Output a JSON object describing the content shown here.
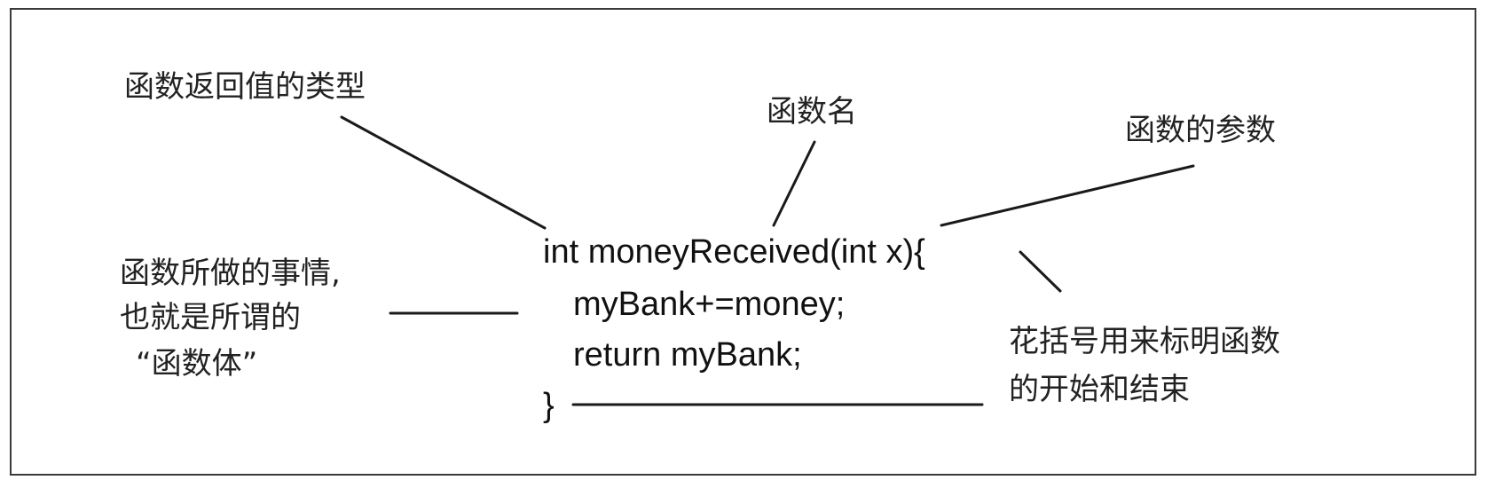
{
  "labels": {
    "return_type": "函数返回值的类型",
    "function_name": "函数名",
    "parameters": "函数的参数",
    "body_line1": "函数所做的事情,",
    "body_line2": "也就是所谓的",
    "body_line3": "“函数体”",
    "braces_line1": "花括号用来标明函数",
    "braces_line2": "的开始和结束"
  },
  "code": {
    "line1": "int moneyReceived(int x){",
    "line2": "myBank+=money;",
    "line3": "return myBank;",
    "line4": "}"
  }
}
